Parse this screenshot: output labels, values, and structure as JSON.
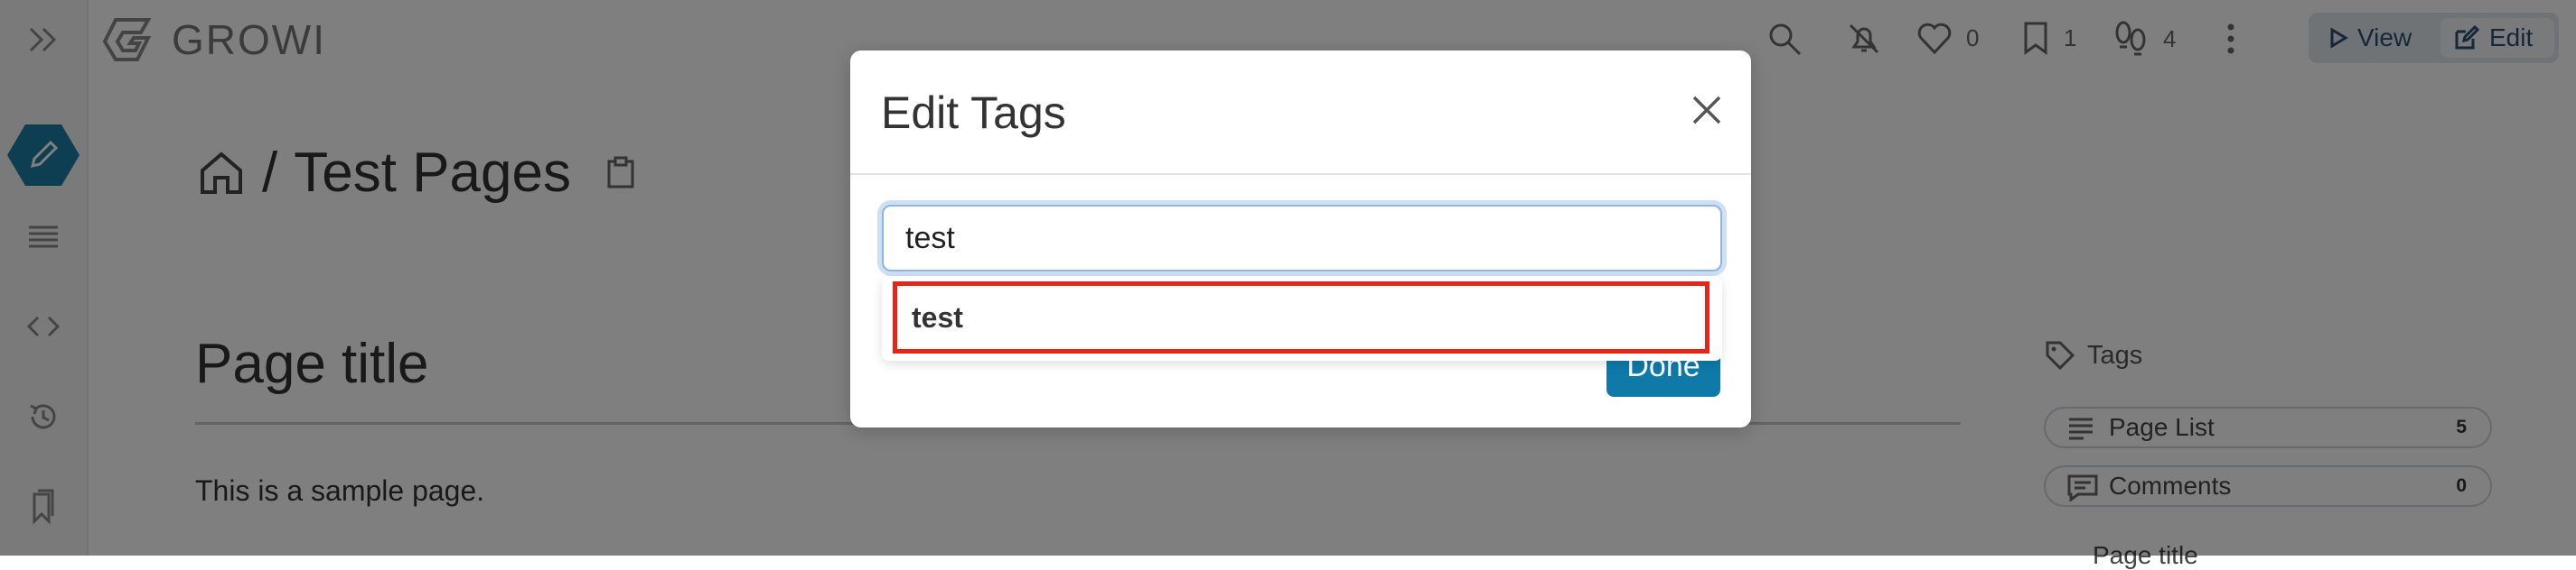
{
  "app": {
    "logo_text": "GROWI"
  },
  "header": {
    "likes_count": "0",
    "bookmarks_count": "1",
    "seen_count": "4",
    "view_label": "View",
    "edit_label": "Edit"
  },
  "page": {
    "path_sep": "/",
    "path": "Test Pages",
    "title": "Page title",
    "body_text": "This is a sample page."
  },
  "side": {
    "tags_label": "Tags",
    "page_list_label": "Page List",
    "page_list_count": "5",
    "comments_label": "Comments",
    "comments_count": "0",
    "toc_item": "Page title"
  },
  "modal": {
    "title": "Edit Tags",
    "input_value": "test",
    "suggestion": "test",
    "done_label": "Done"
  },
  "colors": {
    "accent": "#0f7aa8",
    "highlight": "#e4261a",
    "edit_icon_bg": "#1a7da5"
  }
}
